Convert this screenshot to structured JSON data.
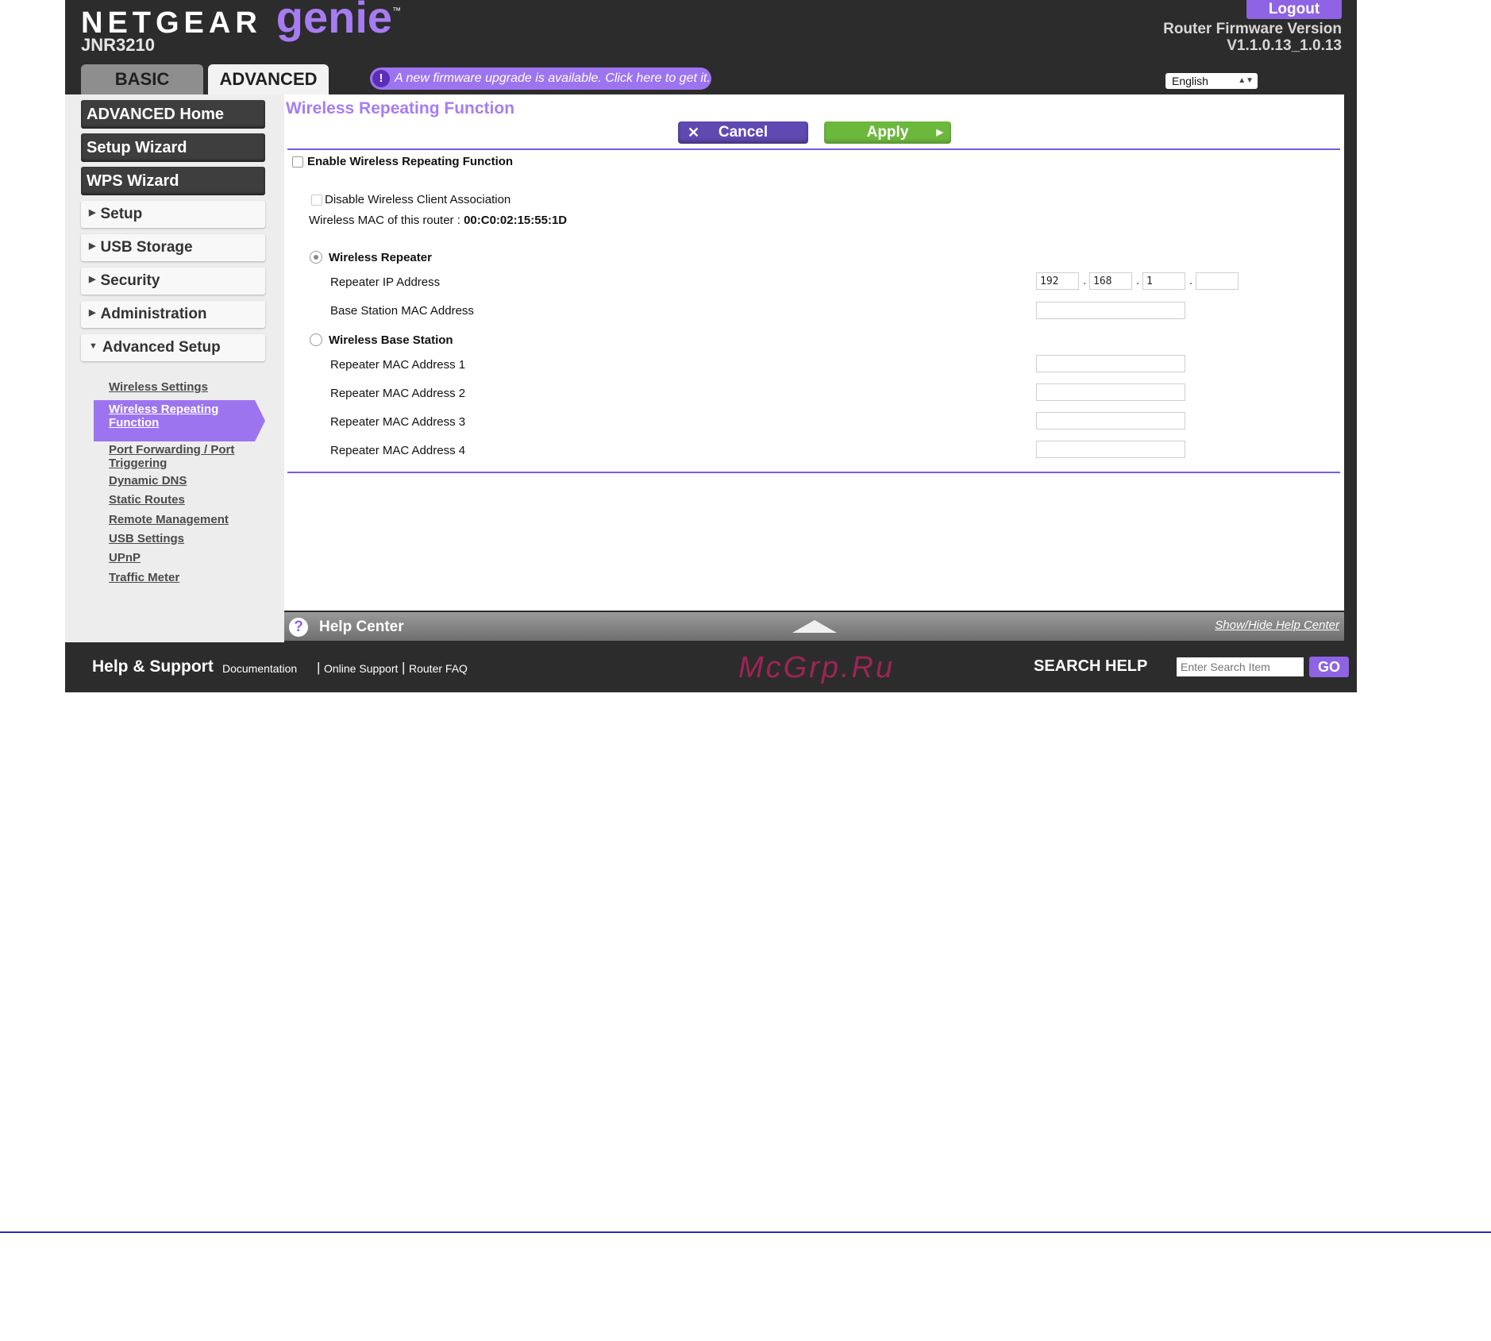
{
  "header": {
    "brand": "NETGEAR",
    "brand_genie": "genie",
    "brand_tm": "™",
    "model": "JNR3210",
    "logout_label": "Logout",
    "firmware_label": "Router Firmware Version",
    "firmware_version": "V1.1.0.13_1.0.13",
    "tabs": [
      {
        "label": "BASIC"
      },
      {
        "label": "ADVANCED",
        "active": true
      }
    ],
    "banner_icon": "!",
    "banner_text": "A new firmware upgrade is available. Click here to get it.",
    "language": "English"
  },
  "sidebar": {
    "main_buttons": [
      {
        "label": "ADVANCED Home"
      },
      {
        "label": "Setup Wizard"
      },
      {
        "label": "WPS Wizard"
      }
    ],
    "sections": [
      {
        "label": "Setup",
        "expanded": false
      },
      {
        "label": "USB Storage",
        "expanded": false
      },
      {
        "label": "Security",
        "expanded": false
      },
      {
        "label": "Administration",
        "expanded": false
      },
      {
        "label": "Advanced Setup",
        "expanded": true
      }
    ],
    "sub_items": [
      {
        "label": "Wireless Settings"
      },
      {
        "label_line1": "Wireless Repeating",
        "label_line2": "Function",
        "active": true
      },
      {
        "label_line1": "Port Forwarding / Port",
        "label_line2": "Triggering"
      },
      {
        "label": "Dynamic DNS"
      },
      {
        "label": "Static Routes"
      },
      {
        "label": "Remote Management"
      },
      {
        "label": "USB Settings"
      },
      {
        "label": "UPnP"
      },
      {
        "label": "Traffic Meter"
      }
    ]
  },
  "main": {
    "title": "Wireless Repeating Function",
    "cancel_label": "Cancel",
    "apply_label": "Apply",
    "enable_label": "Enable Wireless Repeating Function",
    "enable_checked": false,
    "disable_assoc_label": "Disable Wireless Client Association",
    "disable_assoc_checked": false,
    "mac_label": "Wireless MAC of this router :",
    "mac_value": "00:C0:02:15:55:1D",
    "repeater_label": "Wireless Repeater",
    "repeater_selected": true,
    "repeater_ip_label": "Repeater IP Address",
    "repeater_ip": [
      "192",
      "168",
      "1",
      ""
    ],
    "base_station_mac_label": "Base Station MAC Address",
    "base_station_mac_value": "",
    "base_station_label": "Wireless Base Station",
    "base_station_selected": false,
    "repeater_macs": [
      {
        "label": "Repeater MAC Address 1",
        "value": ""
      },
      {
        "label": "Repeater MAC Address 2",
        "value": ""
      },
      {
        "label": "Repeater MAC Address 3",
        "value": ""
      },
      {
        "label": "Repeater MAC Address 4",
        "value": ""
      }
    ]
  },
  "help_center": {
    "icon": "?",
    "title": "Help Center",
    "toggle_label": "Show/Hide Help Center"
  },
  "footer": {
    "title": "Help & Support",
    "links": [
      "Documentation",
      "Online Support",
      "Router FAQ"
    ],
    "separator": "|",
    "search_label": "SEARCH HELP",
    "search_placeholder": "Enter Search Item",
    "go_label": "GO",
    "watermark": "McGrp.Ru"
  },
  "colors": {
    "accent_purple": "#a77cf2",
    "button_purple": "#5e4ab0",
    "apply_green": "#6cb83d",
    "frame_dark": "#2c2c2c"
  }
}
